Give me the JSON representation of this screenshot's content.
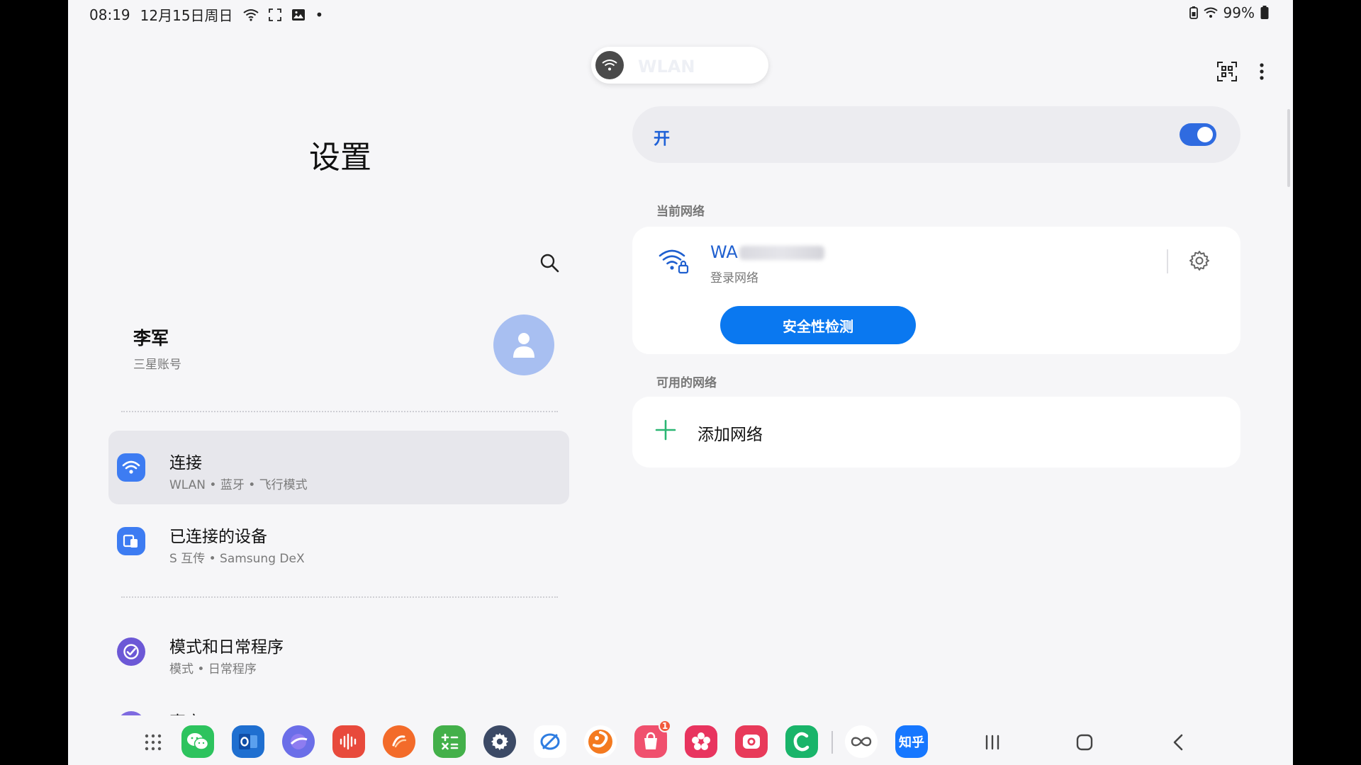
{
  "status_bar": {
    "time": "08:19",
    "date": "12月15日周日",
    "dot": "•",
    "battery_percent": "99%"
  },
  "settings": {
    "title": "设置",
    "account": {
      "name": "李军",
      "subtitle": "三星账号"
    },
    "menu": [
      {
        "title": "连接",
        "subtitle": "WLAN • 蓝牙 • 飞行模式",
        "icon": "wifi-icon",
        "color": "#3d7cf2",
        "active": true
      },
      {
        "title": "已连接的设备",
        "subtitle": "S 互传 • Samsung DeX",
        "icon": "connected-devices-icon",
        "color": "#3d7cf2",
        "active": false
      },
      {
        "title": "模式和日常程序",
        "subtitle": "模式 • 日常程序",
        "icon": "modes-check-icon",
        "color": "#6c58d6",
        "active": false
      },
      {
        "title": "声音",
        "subtitle": "",
        "icon": "sound-icon",
        "color": "#7e6ae0",
        "active": false
      }
    ]
  },
  "wlan": {
    "chip_label": "WLAN",
    "switch_label": "开",
    "switch_on": true,
    "current_network_label": "当前网络",
    "current_network": {
      "name_prefix": "WA",
      "status": "登录网络",
      "security_button": "安全性检测"
    },
    "available_networks_label": "可用的网络",
    "add_network_label": "添加网络"
  },
  "colors": {
    "accent": "#2f6be0",
    "security_button": "#0a78f0",
    "add_plus": "#2bb673"
  },
  "taskbar": {
    "apps": [
      {
        "name": "app-drawer",
        "icon": "grid-icon"
      },
      {
        "name": "wechat",
        "icon": "wechat-icon",
        "color": "#2dc35e"
      },
      {
        "name": "outlook",
        "icon": "outlook-icon",
        "color": "#1f6fd0"
      },
      {
        "name": "internet",
        "icon": "browser-icon",
        "color": "#6b6ee8"
      },
      {
        "name": "voice-recorder",
        "icon": "recorder-icon",
        "color": "#e84a3c"
      },
      {
        "name": "app-orange",
        "icon": "orange-app-icon",
        "color": "#f36b2a"
      },
      {
        "name": "calculator",
        "icon": "calculator-icon",
        "color": "#43b04a"
      },
      {
        "name": "settings",
        "icon": "settings-gear-icon",
        "color": "#3c4a66"
      },
      {
        "name": "app-blue-ring",
        "icon": "ring-app-icon",
        "color": "#2f7de1"
      },
      {
        "name": "app-orange-swirl",
        "icon": "swirl-app-icon",
        "color": "#f47a20"
      },
      {
        "name": "galaxy-store",
        "icon": "store-bag-icon",
        "color": "#f0506e",
        "badge": "1"
      },
      {
        "name": "gallery",
        "icon": "gallery-flower-icon",
        "color": "#e8345f"
      },
      {
        "name": "camera",
        "icon": "camera-icon",
        "color": "#e83a5a"
      },
      {
        "name": "app-green-c",
        "icon": "c-app-icon",
        "color": "#19b46a"
      },
      {
        "name": "app-infinity",
        "icon": "infinity-icon",
        "color": "#ffffff"
      },
      {
        "name": "zhihu",
        "icon": "zhihu-icon",
        "color": "#1677ff",
        "label": "知乎"
      }
    ]
  }
}
